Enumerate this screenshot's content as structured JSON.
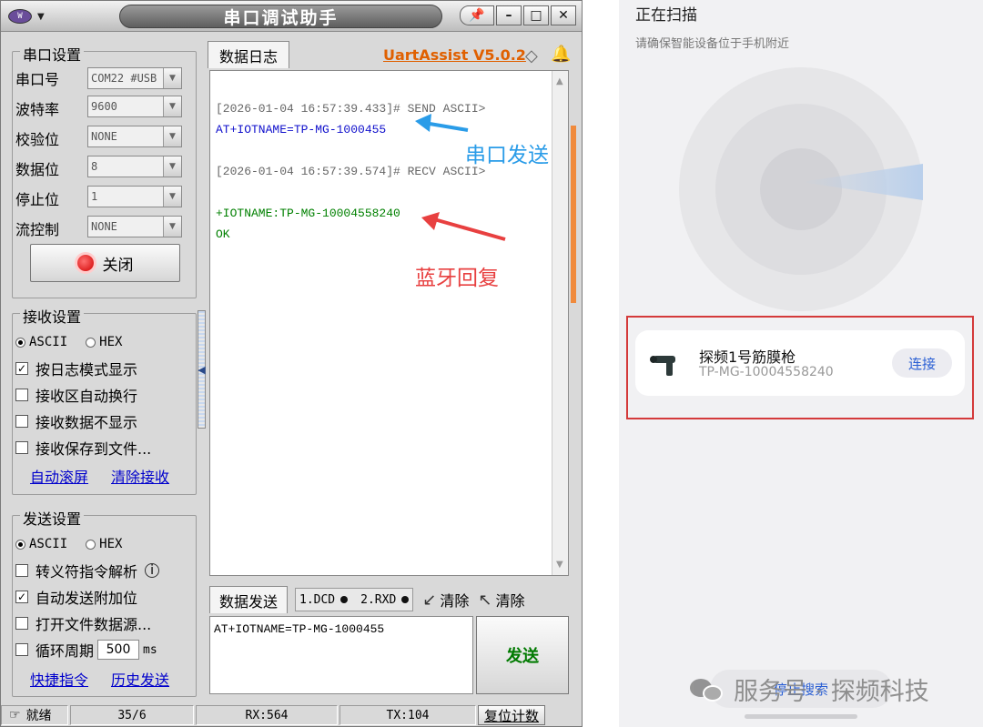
{
  "window": {
    "title": "串口调试助手",
    "brand": "UartAssist V5.0.2"
  },
  "serial_settings": {
    "group_label": "串口设置",
    "fields": [
      {
        "label": "串口号",
        "value": "COM22 #USB"
      },
      {
        "label": "波特率",
        "value": "9600"
      },
      {
        "label": "校验位",
        "value": "NONE"
      },
      {
        "label": "数据位",
        "value": "8"
      },
      {
        "label": "停止位",
        "value": "1"
      },
      {
        "label": "流控制",
        "value": "NONE"
      }
    ],
    "close_button": "关闭"
  },
  "receive_settings": {
    "group_label": "接收设置",
    "radio_ascii": "ASCII",
    "radio_hex": "HEX",
    "checkboxes": [
      {
        "label": "按日志模式显示",
        "checked": true
      },
      {
        "label": "接收区自动换行",
        "checked": false
      },
      {
        "label": "接收数据不显示",
        "checked": false
      },
      {
        "label": "接收保存到文件...",
        "checked": false
      }
    ],
    "link_autoscroll": "自动滚屏",
    "link_clear": "清除接收"
  },
  "send_settings": {
    "group_label": "发送设置",
    "radio_ascii": "ASCII",
    "radio_hex": "HEX",
    "checkboxes": [
      {
        "label": "转义符指令解析",
        "checked": false
      },
      {
        "label": "自动发送附加位",
        "checked": true
      },
      {
        "label": "打开文件数据源...",
        "checked": false
      },
      {
        "label": "循环周期",
        "checked": false
      }
    ],
    "cycle_value": "500",
    "cycle_unit": "ms",
    "link_shortcut": "快捷指令",
    "link_history": "历史发送"
  },
  "log": {
    "tab": "数据日志",
    "lines": [
      {
        "text": "[2026-01-04 16:57:39.433]# SEND ASCII>",
        "color": "#666666"
      },
      {
        "text": "AT+IOTNAME=TP-MG-1000455",
        "color": "#1010cc"
      },
      {
        "text": "[2026-01-04 16:57:39.574]# RECV ASCII>",
        "color": "#666666"
      },
      {
        "text": "+IOTNAME:TP-MG-10004558240",
        "color": "#008000"
      },
      {
        "text": "OK",
        "color": "#008000"
      }
    ],
    "annotation_send": "串口发送",
    "annotation_recv": "蓝牙回复",
    "annotation_send_color": "#2a9ce8",
    "annotation_recv_color": "#e84040"
  },
  "send_area": {
    "tab": "数据发送",
    "led_dcd": "1.DCD",
    "led_rxd": "2.RXD",
    "clear1": "清除",
    "clear2": "清除",
    "input_value": "AT+IOTNAME=TP-MG-1000455",
    "send_button": "发送"
  },
  "statusbar": {
    "ready": "就绪",
    "count": "35/6",
    "rx": "RX:564",
    "tx": "TX:104",
    "reset": "复位计数"
  },
  "phone": {
    "title": "正在扫描",
    "hint": "请确保智能设备位于手机附近",
    "device_name": "探频1号筋膜枪",
    "device_id": "TP-MG-10004558240",
    "connect": "连接",
    "stop_scan": "停止搜索"
  },
  "watermark": "服务号 · 探频科技"
}
